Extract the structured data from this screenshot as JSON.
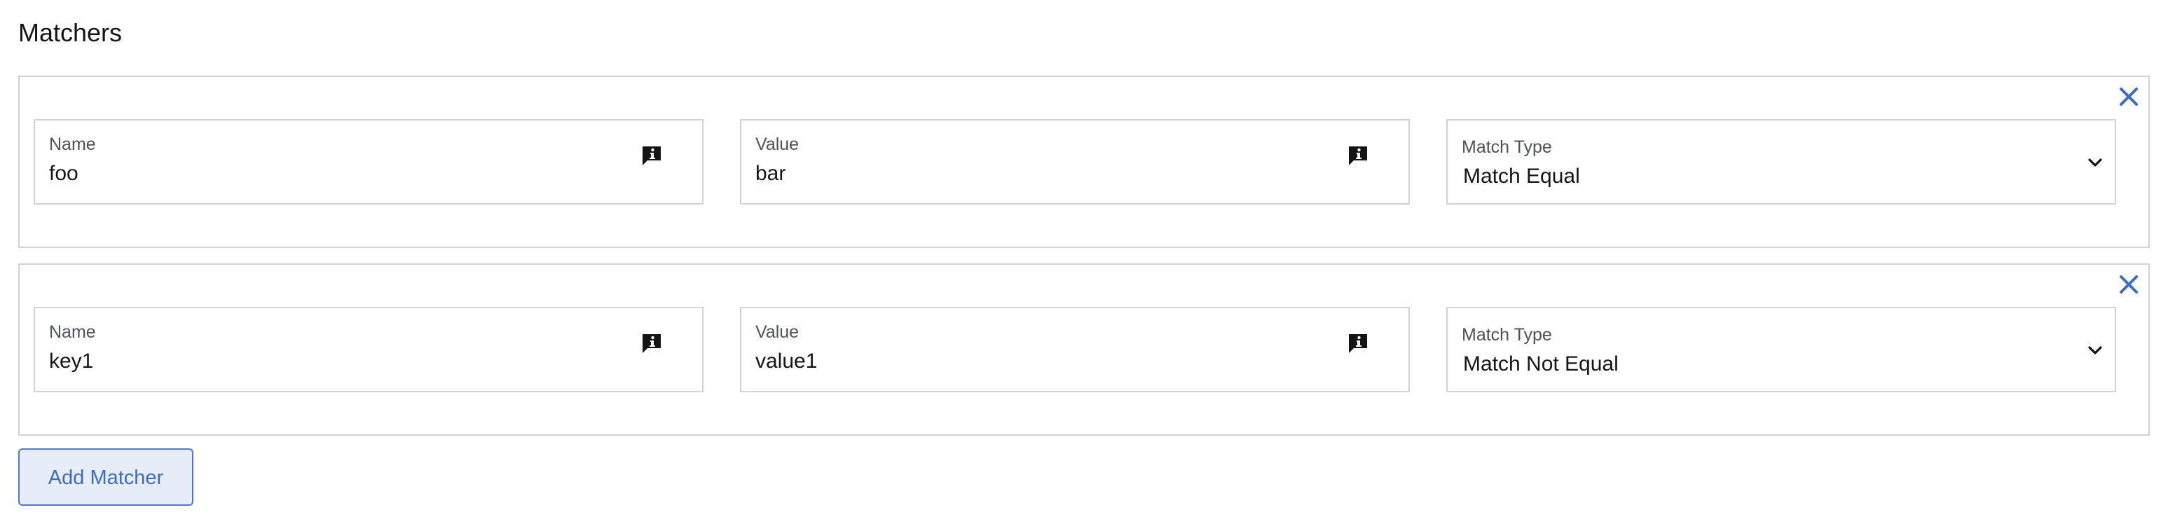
{
  "section": {
    "title": "Matchers"
  },
  "matchers": [
    {
      "name_label": "Name",
      "name_value": "foo",
      "value_label": "Value",
      "value_value": "bar",
      "type_label": "Match Type",
      "type_value": "Match Equal"
    },
    {
      "name_label": "Name",
      "name_value": "key1",
      "value_label": "Value",
      "value_value": "value1",
      "type_label": "Match Type",
      "type_value": "Match Not Equal"
    }
  ],
  "actions": {
    "add_matcher_label": "Add Matcher"
  },
  "icons": {
    "remove": "close-icon",
    "info": "info-icon",
    "dropdown": "chevron-down-icon"
  },
  "colors": {
    "accent": "#3e6cc0",
    "border": "#d2d2d2",
    "button_bg": "#e7edf8"
  }
}
